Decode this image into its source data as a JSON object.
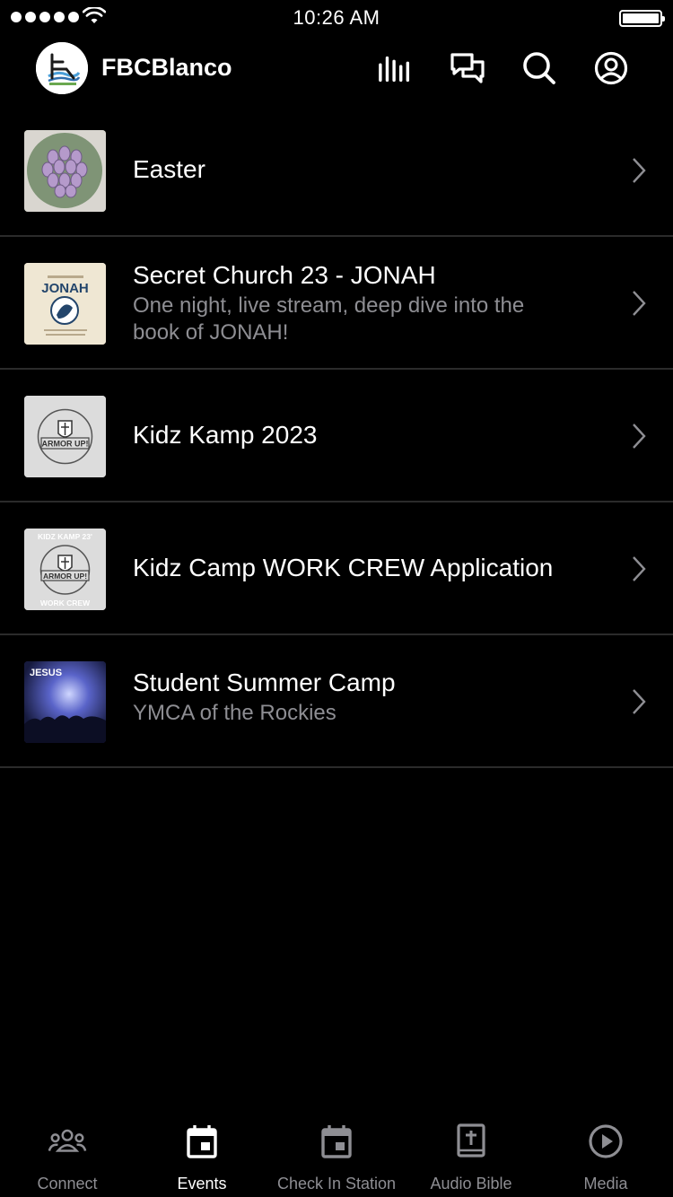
{
  "status_bar": {
    "time": "10:26 AM"
  },
  "header": {
    "app_title": "FBCBlanco",
    "icons": [
      "audio-bars-icon",
      "chat-icon",
      "search-icon",
      "profile-icon"
    ]
  },
  "events": [
    {
      "title": "Easter",
      "subtitle": ""
    },
    {
      "title": "Secret Church 23 - JONAH",
      "subtitle_line1": "One night, live stream, deep dive into the",
      "subtitle_line2": "book of JONAH!"
    },
    {
      "title": "Kidz Kamp 2023",
      "subtitle": ""
    },
    {
      "title": "Kidz Camp WORK CREW Application",
      "subtitle": ""
    },
    {
      "title": "Student Summer Camp",
      "subtitle": "YMCA of the Rockies"
    }
  ],
  "thumbnails": {
    "jonah_text": "JONAH",
    "armor_text": "ARMOR UP!",
    "kidz_kamp_text": "KIDZ KAMP 23'",
    "work_crew_text": "WORK CREW",
    "jesus_text": "JESUS"
  },
  "tabs": [
    {
      "label": "Connect",
      "icon": "people-icon",
      "active": false
    },
    {
      "label": "Events",
      "icon": "calendar-icon",
      "active": true
    },
    {
      "label": "Check In Station",
      "icon": "calendar-check-icon",
      "active": false
    },
    {
      "label": "Audio Bible",
      "icon": "bible-icon",
      "active": false
    },
    {
      "label": "Media",
      "icon": "play-circle-icon",
      "active": false
    }
  ],
  "colors": {
    "background": "#000000",
    "divider": "#2b2b2b",
    "secondary_text": "#8e8e93",
    "active_tab": "#ffffff"
  }
}
